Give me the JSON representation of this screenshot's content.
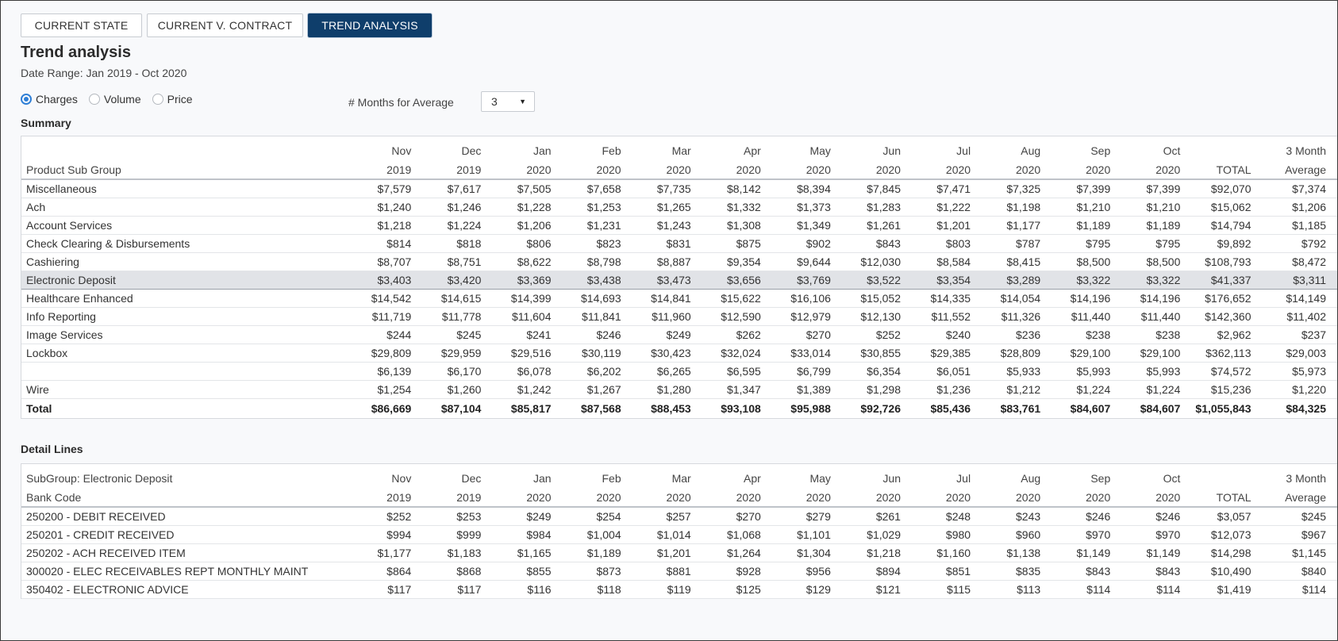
{
  "tabs": [
    {
      "label": "CURRENT STATE",
      "active": false
    },
    {
      "label": "CURRENT V. CONTRACT",
      "active": false
    },
    {
      "label": "TREND ANALYSIS",
      "active": true
    }
  ],
  "header": {
    "title": "Trend analysis",
    "date_range": "Date Range: Jan 2019 - Oct 2020"
  },
  "view_options": {
    "charges": "Charges",
    "volume": "Volume",
    "price": "Price",
    "selected": "Charges"
  },
  "average": {
    "label": "# Months for Average",
    "value": "3"
  },
  "columns": {
    "months": [
      "Nov",
      "Dec",
      "Jan",
      "Feb",
      "Mar",
      "Apr",
      "May",
      "Jun",
      "Jul",
      "Aug",
      "Sep",
      "Oct"
    ],
    "years": [
      "2019",
      "2019",
      "2020",
      "2020",
      "2020",
      "2020",
      "2020",
      "2020",
      "2020",
      "2020",
      "2020",
      "2020"
    ],
    "total": "TOTAL",
    "avg_top": "3 Month",
    "avg_bottom": "Average"
  },
  "summary": {
    "section_label": "Summary",
    "header_label": "Product Sub Group",
    "rows": [
      {
        "label": "Miscellaneous",
        "values": [
          "$7,579",
          "$7,617",
          "$7,505",
          "$7,658",
          "$7,735",
          "$8,142",
          "$8,394",
          "$7,845",
          "$7,471",
          "$7,325",
          "$7,399",
          "$7,399",
          "$92,070",
          "$7,374"
        ]
      },
      {
        "label": "Ach",
        "values": [
          "$1,240",
          "$1,246",
          "$1,228",
          "$1,253",
          "$1,265",
          "$1,332",
          "$1,373",
          "$1,283",
          "$1,222",
          "$1,198",
          "$1,210",
          "$1,210",
          "$15,062",
          "$1,206"
        ]
      },
      {
        "label": "Account Services",
        "values": [
          "$1,218",
          "$1,224",
          "$1,206",
          "$1,231",
          "$1,243",
          "$1,308",
          "$1,349",
          "$1,261",
          "$1,201",
          "$1,177",
          "$1,189",
          "$1,189",
          "$14,794",
          "$1,185"
        ]
      },
      {
        "label": "Check Clearing & Disbursements",
        "values": [
          "$814",
          "$818",
          "$806",
          "$823",
          "$831",
          "$875",
          "$902",
          "$843",
          "$803",
          "$787",
          "$795",
          "$795",
          "$9,892",
          "$792"
        ]
      },
      {
        "label": "Cashiering",
        "values": [
          "$8,707",
          "$8,751",
          "$8,622",
          "$8,798",
          "$8,887",
          "$9,354",
          "$9,644",
          "$12,030",
          "$8,584",
          "$8,415",
          "$8,500",
          "$8,500",
          "$108,793",
          "$8,472"
        ]
      },
      {
        "label": "Electronic Deposit",
        "highlight": true,
        "values": [
          "$3,403",
          "$3,420",
          "$3,369",
          "$3,438",
          "$3,473",
          "$3,656",
          "$3,769",
          "$3,522",
          "$3,354",
          "$3,289",
          "$3,322",
          "$3,322",
          "$41,337",
          "$3,311"
        ]
      },
      {
        "label": "Healthcare Enhanced",
        "values": [
          "$14,542",
          "$14,615",
          "$14,399",
          "$14,693",
          "$14,841",
          "$15,622",
          "$16,106",
          "$15,052",
          "$14,335",
          "$14,054",
          "$14,196",
          "$14,196",
          "$176,652",
          "$14,149"
        ]
      },
      {
        "label": "Info Reporting",
        "values": [
          "$11,719",
          "$11,778",
          "$11,604",
          "$11,841",
          "$11,960",
          "$12,590",
          "$12,979",
          "$12,130",
          "$11,552",
          "$11,326",
          "$11,440",
          "$11,440",
          "$142,360",
          "$11,402"
        ]
      },
      {
        "label": "Image Services",
        "values": [
          "$244",
          "$245",
          "$241",
          "$246",
          "$249",
          "$262",
          "$270",
          "$252",
          "$240",
          "$236",
          "$238",
          "$238",
          "$2,962",
          "$237"
        ]
      },
      {
        "label": "Lockbox",
        "values": [
          "$29,809",
          "$29,959",
          "$29,516",
          "$30,119",
          "$30,423",
          "$32,024",
          "$33,014",
          "$30,855",
          "$29,385",
          "$28,809",
          "$29,100",
          "$29,100",
          "$362,113",
          "$29,003"
        ]
      },
      {
        "label": "",
        "values": [
          "$6,139",
          "$6,170",
          "$6,078",
          "$6,202",
          "$6,265",
          "$6,595",
          "$6,799",
          "$6,354",
          "$6,051",
          "$5,933",
          "$5,993",
          "$5,993",
          "$74,572",
          "$5,973"
        ]
      },
      {
        "label": "Wire",
        "values": [
          "$1,254",
          "$1,260",
          "$1,242",
          "$1,267",
          "$1,280",
          "$1,347",
          "$1,389",
          "$1,298",
          "$1,236",
          "$1,212",
          "$1,224",
          "$1,224",
          "$15,236",
          "$1,220"
        ]
      }
    ],
    "total": {
      "label": "Total",
      "values": [
        "$86,669",
        "$87,104",
        "$85,817",
        "$87,568",
        "$88,453",
        "$93,108",
        "$95,988",
        "$92,726",
        "$85,436",
        "$83,761",
        "$84,607",
        "$84,607",
        "$1,055,843",
        "$84,325"
      ]
    }
  },
  "detail": {
    "section_label": "Detail Lines",
    "subgroup_label": "SubGroup: Electronic Deposit",
    "header_label": "Bank Code",
    "rows": [
      {
        "label": "250200 - DEBIT RECEIVED",
        "values": [
          "$252",
          "$253",
          "$249",
          "$254",
          "$257",
          "$270",
          "$279",
          "$261",
          "$248",
          "$243",
          "$246",
          "$246",
          "$3,057",
          "$245"
        ]
      },
      {
        "label": "250201 - CREDIT RECEIVED",
        "values": [
          "$994",
          "$999",
          "$984",
          "$1,004",
          "$1,014",
          "$1,068",
          "$1,101",
          "$1,029",
          "$980",
          "$960",
          "$970",
          "$970",
          "$12,073",
          "$967"
        ]
      },
      {
        "label": "250202 - ACH RECEIVED ITEM",
        "values": [
          "$1,177",
          "$1,183",
          "$1,165",
          "$1,189",
          "$1,201",
          "$1,264",
          "$1,304",
          "$1,218",
          "$1,160",
          "$1,138",
          "$1,149",
          "$1,149",
          "$14,298",
          "$1,145"
        ]
      },
      {
        "label": "300020 - ELEC RECEIVABLES REPT MONTHLY MAINT",
        "values": [
          "$864",
          "$868",
          "$855",
          "$873",
          "$881",
          "$928",
          "$956",
          "$894",
          "$851",
          "$835",
          "$843",
          "$843",
          "$10,490",
          "$840"
        ]
      },
      {
        "label": "350402 - ELECTRONIC ADVICE",
        "values": [
          "$117",
          "$117",
          "$116",
          "$118",
          "$119",
          "$125",
          "$129",
          "$121",
          "$115",
          "$113",
          "$114",
          "$114",
          "$1,419",
          "$114"
        ]
      }
    ]
  }
}
